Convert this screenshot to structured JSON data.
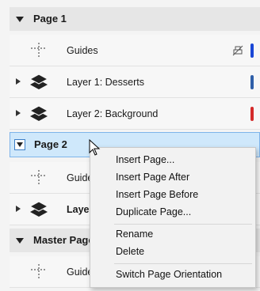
{
  "panel": {
    "page1": {
      "label": "Page 1"
    },
    "guides1": {
      "label": "Guides"
    },
    "layer1": {
      "label": "Layer 1: Desserts",
      "color": "#2f5fa8"
    },
    "layer2": {
      "label": "Layer 2: Background",
      "color": "#d42a2a"
    },
    "page2": {
      "label": "Page 2"
    },
    "guides2": {
      "label": "Guide"
    },
    "layer_p2": {
      "label": "Layer"
    },
    "master": {
      "label": "Master Page"
    },
    "guides3": {
      "label": "Guide"
    },
    "guides_color": "#1a47d6"
  },
  "context_menu": {
    "items": [
      {
        "label": "Insert Page..."
      },
      {
        "label": "Insert Page After"
      },
      {
        "label": "Insert Page Before"
      },
      {
        "label": "Duplicate Page..."
      },
      {
        "label": "Rename"
      },
      {
        "label": "Delete"
      },
      {
        "label": "Switch Page Orientation"
      }
    ]
  },
  "icons": {
    "guides": "guides-icon",
    "layer": "layers-icon",
    "print": "print-disabled-icon",
    "cursor": "mouse-pointer-icon"
  }
}
